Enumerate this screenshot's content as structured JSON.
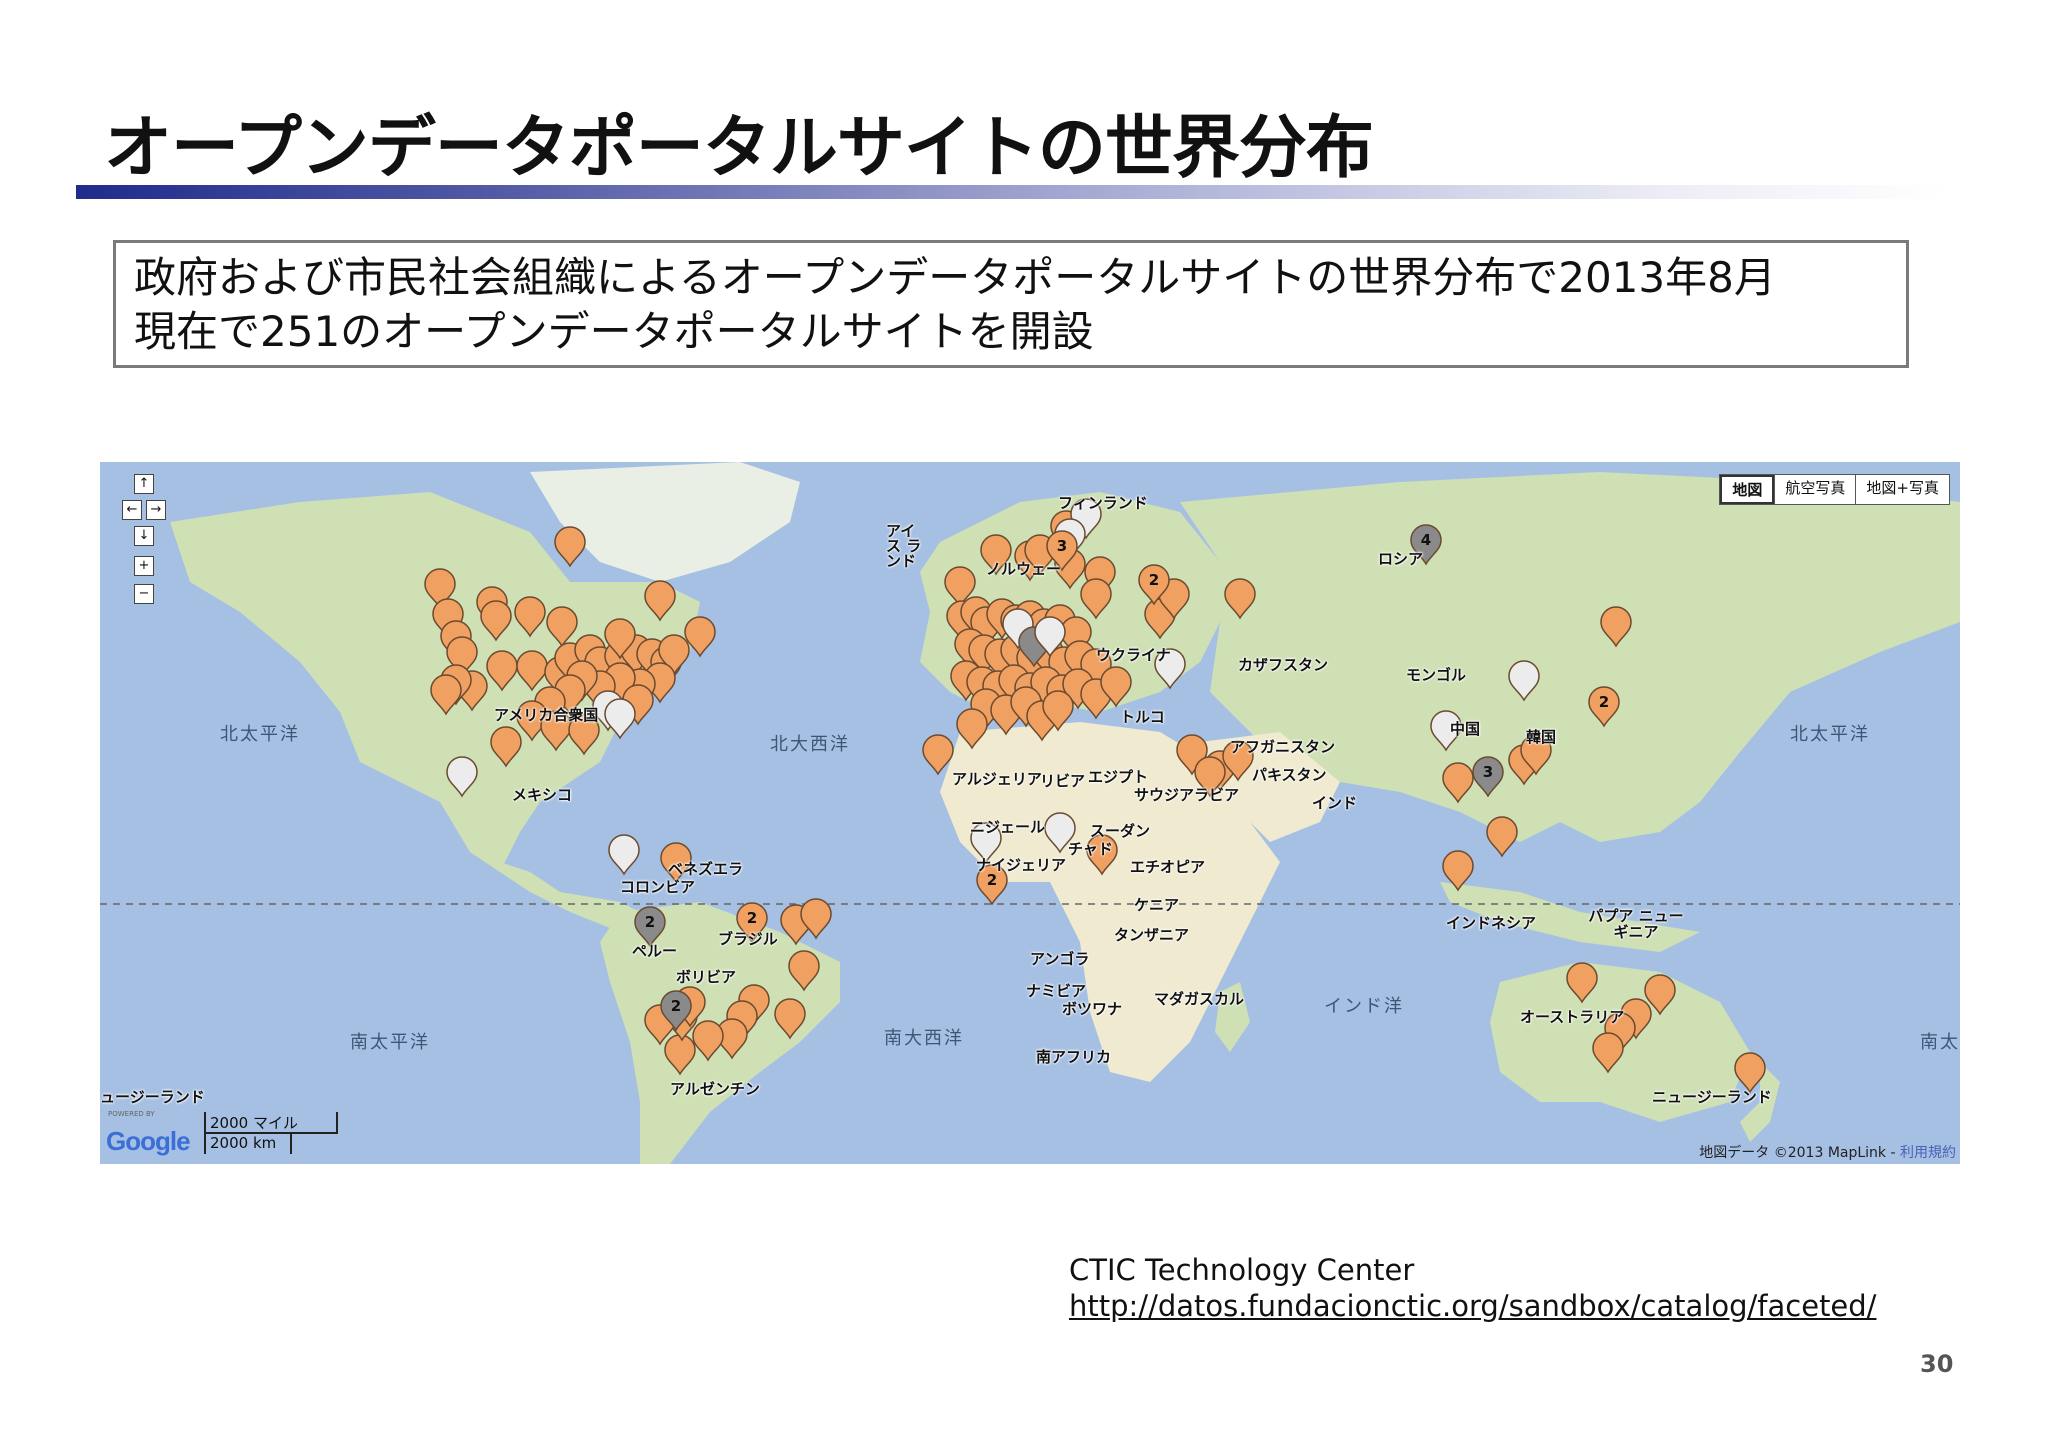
{
  "slide": {
    "title": "オープンデータポータルサイトの世界分布",
    "summary_line1": "政府および市民社会組織によるオープンデータポータルサイトの世界分布で2013年8月",
    "summary_line2": "現在で251のオープンデータポータルサイトを開設",
    "credit_org": "CTIC Technology Center",
    "credit_url": "http://datos.fundacionctic.org/sandbox/catalog/faceted/",
    "page_number": "30"
  },
  "map": {
    "map_type_buttons": [
      "地図",
      "航空写真",
      "地図+写真"
    ],
    "scale_miles": "2000 マイル",
    "scale_km": "2000 km",
    "powered_by": "POWERED BY",
    "logo_text": "Google",
    "attribution": "地図データ ©2013 MapLink - ",
    "terms_link": "利用規約",
    "colors": {
      "ocean": "#a6c0e4",
      "land": "#cfe0b4",
      "marker_orange": "#f0a060",
      "marker_grey": "#8a8a8a",
      "marker_white": "#ececec"
    },
    "place_labels": {
      "finland": "フィンランド",
      "iceland": "アイス ランド",
      "norway": "ノルウェー",
      "russia": "ロシア",
      "ukraine": "ウクライナ",
      "kazakhstan": "カザフスタン",
      "mongolia": "モンゴル",
      "turkey": "トルコ",
      "korea": "韓国",
      "afghanistan": "アフガニスタン",
      "pakistan": "パキスタン",
      "india": "インド",
      "usa": "アメリカ合衆国",
      "mexico": "メキシコ",
      "venezuela": "ベネズエラ",
      "colombia": "コロンビア",
      "peru": "ペルー",
      "brazil": "ブラジル",
      "bolivia": "ボリビア",
      "argentina": "アルゼンチン",
      "algeria": "アルジェリア",
      "libya": "リビア",
      "egypt": "エジプト",
      "saudi": "サウジアラビア",
      "niger": "ニジェール",
      "sudan": "スーダン",
      "chad": "チャド",
      "nigeria": "ナイジェリア",
      "ethiopia": "エチオピア",
      "kenya": "ケニア",
      "tanzania": "タンザニア",
      "angola": "アンゴラ",
      "namibia": "ナミビア",
      "botswana": "ボツワナ",
      "madagascar": "マダガスカル",
      "south_africa": "南アフリカ",
      "indonesia": "インドネシア",
      "png": "パプア ニューギニア",
      "australia": "オーストラリア",
      "new_zealand": "ニュージーランド",
      "new_zealand_left": "ュージーランド",
      "china": "中国"
    },
    "ocean_labels": {
      "n_pacific_left": "北太平洋",
      "n_atlantic": "北大西洋",
      "n_pacific_right": "北太平洋",
      "s_pacific_left": "南太平洋",
      "s_atlantic": "南大西洋",
      "indian": "インド洋",
      "s_pacific_right": "南太"
    },
    "cluster_counts": {
      "c1": "3",
      "c2": "2",
      "c3": "4",
      "c4": "2",
      "c5": "2",
      "c6": "3",
      "c7": "2",
      "c8": "2",
      "c9": "2"
    }
  }
}
